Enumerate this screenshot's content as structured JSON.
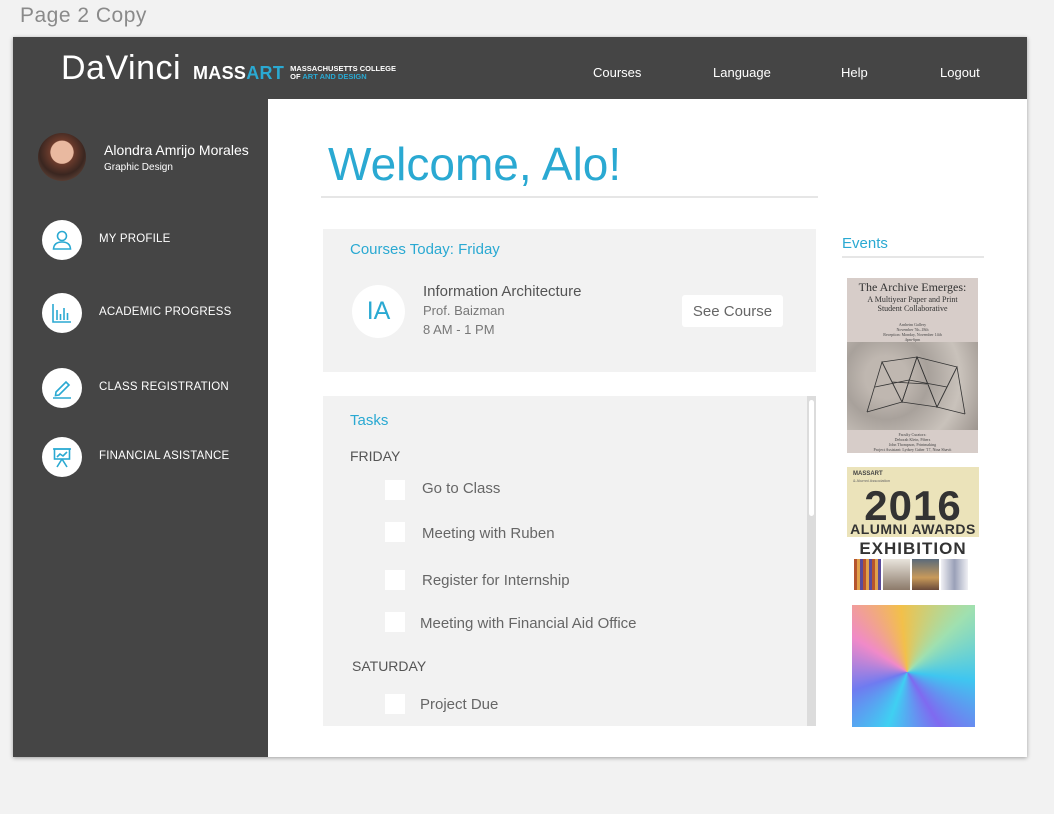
{
  "page_label": "Page 2 Copy",
  "header": {
    "app_name": "DaVinci",
    "logo": {
      "word_a": "MASS",
      "word_b": "ART",
      "sub_line1": "MASSACHUSETTS COLLEGE",
      "sub_line2_a": "OF ",
      "sub_line2_b": "ART AND DESIGN"
    },
    "nav": [
      "Courses",
      "Language",
      "Help",
      "Logout"
    ]
  },
  "user": {
    "name": "Alondra Amrijo Morales",
    "department": "Graphic Design"
  },
  "sidebar": {
    "items": [
      {
        "label": "MY PROFILE",
        "icon": "user-icon"
      },
      {
        "label": "ACADEMIC PROGRESS",
        "icon": "bar-chart-icon"
      },
      {
        "label": "CLASS REGISTRATION",
        "icon": "pencil-icon"
      },
      {
        "label": "FINANCIAL ASISTANCE",
        "icon": "presentation-icon"
      }
    ]
  },
  "welcome": "Welcome, Alo!",
  "courses_today": {
    "title": "Courses Today:  Friday",
    "course": {
      "initials": "IA",
      "name": "Information Architecture",
      "professor": "Prof. Baizman",
      "time": "8 AM - 1 PM"
    },
    "button": "See Course"
  },
  "tasks": {
    "title": "Tasks",
    "days": [
      {
        "day": "FRIDAY",
        "items": [
          "Go to Class",
          "Meeting with Ruben",
          "Register for Internship",
          "Meeting with Financial Aid Office"
        ]
      },
      {
        "day": "SATURDAY",
        "items": [
          "Project Due"
        ]
      }
    ]
  },
  "events": {
    "title": "Events",
    "poster1": {
      "title": "The Archive Emerges:",
      "subtitle_1": "A Multiyear Paper and Print",
      "subtitle_2": "Student Collaborative",
      "fine_1": "Arnheim Gallery",
      "fine_2": "November 7th–18th",
      "fine_3": "Reception: Monday, November 14th",
      "fine_4": "4pm-6pm",
      "foot_1": "Faculty Curators:",
      "foot_2": "Deborah Klein, Fibers",
      "foot_3": "John Thompson, Printmaking",
      "foot_4": "Project Assistant: Lydsey Gaber '17, Nina Shavit"
    },
    "poster2": {
      "brand": "MASSART",
      "tag": "& Alumni Association",
      "year": "2016",
      "line1": "ALUMNI AWARDS",
      "line2": "EXHIBITION"
    }
  },
  "colors": {
    "accent": "#2aa9d2",
    "dark": "#454545",
    "panel": "#f2f2f2"
  }
}
